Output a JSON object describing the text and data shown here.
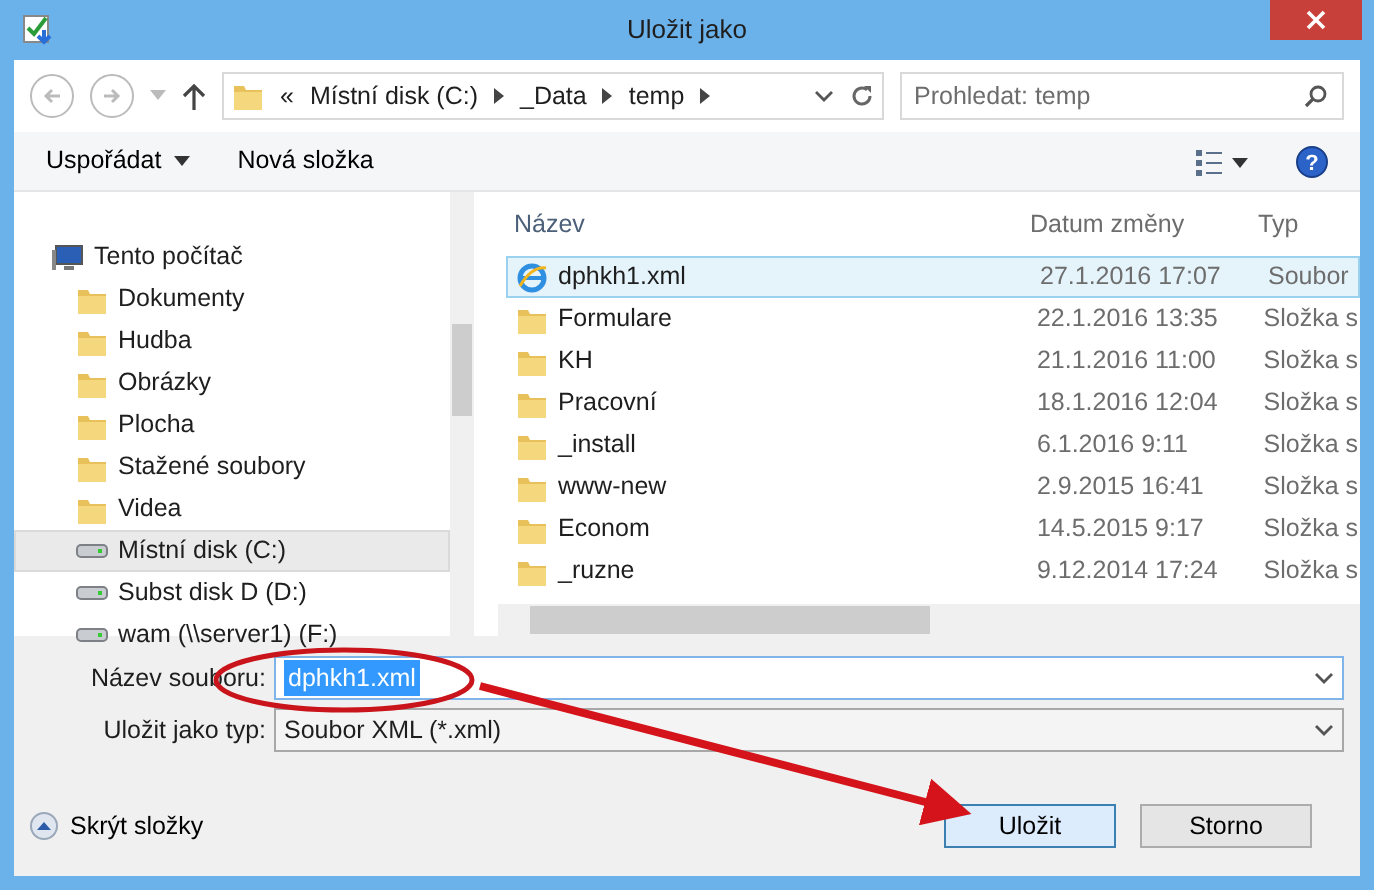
{
  "window": {
    "title": "Uložit jako"
  },
  "address": {
    "segments": [
      "Místní disk (C:)",
      "_Data",
      "temp"
    ],
    "prefix": "«"
  },
  "search": {
    "placeholder": "Prohledat: temp"
  },
  "toolbar": {
    "organize": "Uspořádat",
    "new_folder": "Nová složka",
    "help": "?"
  },
  "sidebar": {
    "items": [
      {
        "label": "Tento počítač",
        "kind": "computer",
        "selected": false,
        "children": [
          {
            "label": "Dokumenty",
            "kind": "folder",
            "selected": false
          },
          {
            "label": "Hudba",
            "kind": "folder",
            "selected": false
          },
          {
            "label": "Obrázky",
            "kind": "folder",
            "selected": false
          },
          {
            "label": "Plocha",
            "kind": "folder",
            "selected": false
          },
          {
            "label": "Stažené soubory",
            "kind": "folder",
            "selected": false
          },
          {
            "label": "Videa",
            "kind": "folder",
            "selected": false
          },
          {
            "label": "Místní disk (C:)",
            "kind": "drive",
            "selected": true
          },
          {
            "label": "Subst disk D (D:)",
            "kind": "drive",
            "selected": false
          },
          {
            "label": "wam (\\\\server1) (F:)",
            "kind": "drive",
            "selected": false
          }
        ]
      }
    ]
  },
  "table": {
    "columns": [
      "Název",
      "Datum změny",
      "Typ"
    ],
    "rows": [
      {
        "name": "dphkh1.xml",
        "date": "27.1.2016 17:07",
        "type": "Soubor",
        "kind": "file",
        "selected": true
      },
      {
        "name": "Formulare",
        "date": "22.1.2016 13:35",
        "type": "Složka s",
        "kind": "folder",
        "selected": false
      },
      {
        "name": "KH",
        "date": "21.1.2016 11:00",
        "type": "Složka s",
        "kind": "folder",
        "selected": false
      },
      {
        "name": "Pracovní",
        "date": "18.1.2016 12:04",
        "type": "Složka s",
        "kind": "folder",
        "selected": false
      },
      {
        "name": "_install",
        "date": "6.1.2016 9:11",
        "type": "Složka s",
        "kind": "folder",
        "selected": false
      },
      {
        "name": "www-new",
        "date": "2.9.2015 16:41",
        "type": "Složka s",
        "kind": "folder",
        "selected": false
      },
      {
        "name": "Econom",
        "date": "14.5.2015 9:17",
        "type": "Složka s",
        "kind": "folder",
        "selected": false
      },
      {
        "name": "_ruzne",
        "date": "9.12.2014 17:24",
        "type": "Složka s",
        "kind": "folder",
        "selected": false
      }
    ]
  },
  "form": {
    "filename_label": "Název souboru:",
    "filename": "dphkh1.xml",
    "type_label": "Uložit jako typ:",
    "type": "Soubor XML (*.xml)"
  },
  "footer": {
    "hide_folders": "Skrýt složky",
    "save": "Uložit",
    "cancel": "Storno"
  }
}
